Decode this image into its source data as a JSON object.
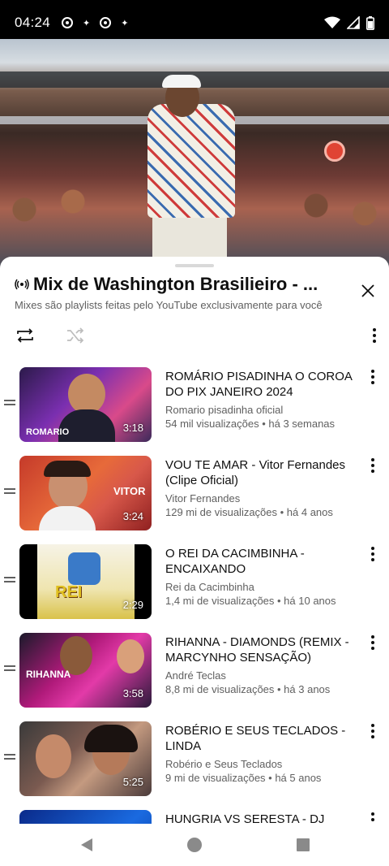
{
  "status_bar": {
    "time": "04:24"
  },
  "playlist": {
    "title": "Mix de Washington Brasilieiro - ...",
    "subtitle": "Mixes são playlists feitas pelo YouTube exclusivamente para você"
  },
  "icons": {
    "broadcast": "broadcast-icon",
    "close": "close-icon",
    "loop": "loop-icon",
    "shuffle": "shuffle-icon",
    "more": "more-vert-icon"
  },
  "videos": [
    {
      "title": "ROMÁRIO PISADINHA  O COROA DO  PIX JANEIRO 2024",
      "channel": "Romario pisadinha oficial",
      "stats": "54 mil visualizações • há 3 semanas",
      "duration": "3:18",
      "thumb_text": "ROMARIO"
    },
    {
      "title": "VOU TE AMAR - Vitor Fernandes (Clipe Oficial)",
      "channel": "Vitor Fernandes",
      "stats": "129 mi de visualizações • há 4 anos",
      "duration": "3:24",
      "thumb_text": "VITOR"
    },
    {
      "title": "O REI DA CACIMBINHA - ENCAIXANDO",
      "channel": "Rei da Cacimbinha",
      "stats": "1,4 mi de visualizações • há 10 anos",
      "duration": "2:29",
      "thumb_text": "REI"
    },
    {
      "title": "RIHANNA - DIAMONDS (REMIX - MARCYNHO SENSAÇÃO)",
      "channel": "André Teclas",
      "stats": "8,8 mi de visualizações • há 3 anos",
      "duration": "3:58",
      "thumb_text": "RIHANNA"
    },
    {
      "title": "ROBÉRIO E SEUS TECLADOS - LINDA",
      "channel": "Robério e Seus Teclados",
      "stats": "9 mi de visualizações • há 5 anos",
      "duration": "5:25",
      "thumb_text": ""
    },
    {
      "title": "HUNGRIA VS SERESTA - DJ MELK",
      "channel": "",
      "stats": "",
      "duration": "",
      "thumb_text": ""
    }
  ]
}
